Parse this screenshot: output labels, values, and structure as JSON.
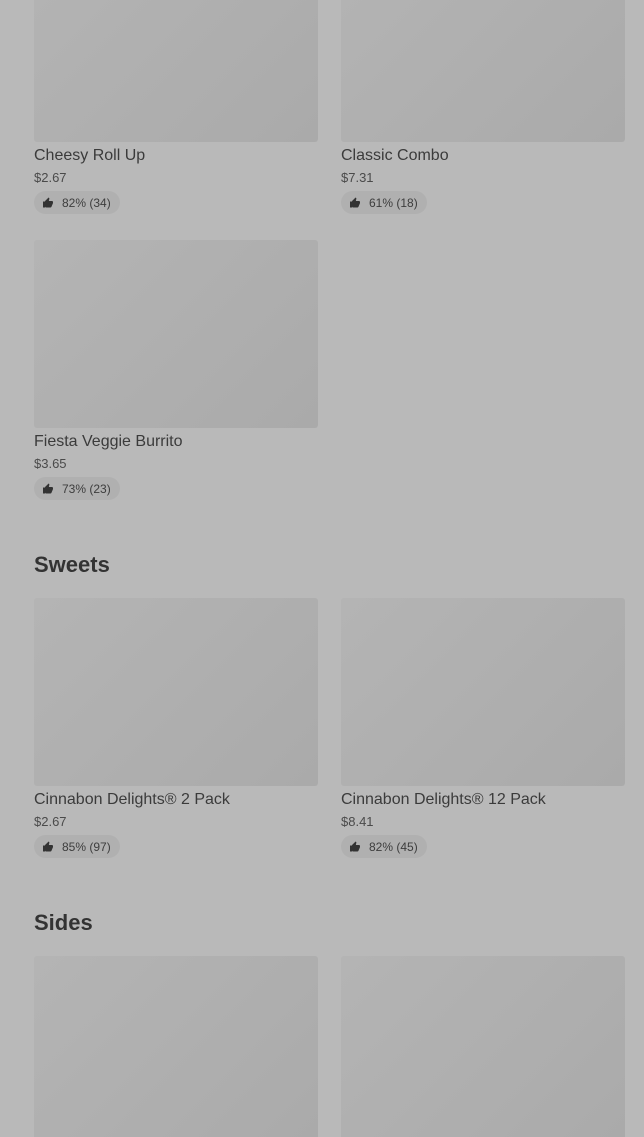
{
  "items_top": [
    {
      "name": "Cheesy Roll Up",
      "price": "$2.67",
      "rating": "82% (34)"
    },
    {
      "name": "Classic Combo",
      "price": "$7.31",
      "rating": "61% (18)"
    },
    {
      "name": "Fiesta Veggie Burrito",
      "price": "$3.65",
      "rating": "73% (23)"
    }
  ],
  "sweets": {
    "title": "Sweets",
    "items": [
      {
        "name": "Cinnabon Delights® 2 Pack",
        "price": "$2.67",
        "rating": "85% (97)"
      },
      {
        "name": "Cinnabon Delights® 12 Pack",
        "price": "$8.41",
        "rating": "82% (45)"
      }
    ]
  },
  "sides": {
    "title": "Sides"
  },
  "icons": {
    "rating": "thumbs-up-icon"
  }
}
